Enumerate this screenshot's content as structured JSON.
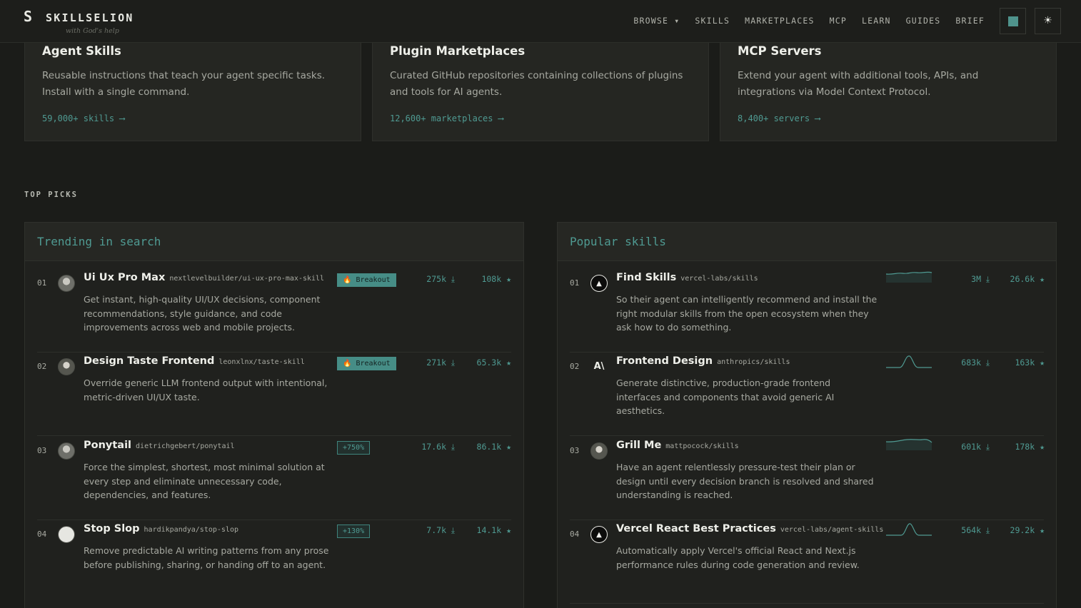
{
  "brand": {
    "mark": "S",
    "name": "SKILLSELION",
    "tagline": "with God's help"
  },
  "nav": {
    "links": [
      "BROWSE ▾",
      "SKILLS",
      "MARKETPLACES",
      "MCP",
      "LEARN",
      "GUIDES",
      "BRIEF"
    ],
    "mode_icon": "☀"
  },
  "cards": [
    {
      "title": "Agent Skills",
      "desc": "Reusable instructions that teach your agent specific tasks. Install with a single command.",
      "count": "59,000+ skills  ⟶"
    },
    {
      "title": "Plugin Marketplaces",
      "desc": "Curated GitHub repositories containing collections of plugins and tools for AI agents.",
      "count": "12,600+ marketplaces  ⟶"
    },
    {
      "title": "MCP Servers",
      "desc": "Extend your agent with additional tools, APIs, and integrations via Model Context Protocol.",
      "count": "8,400+ servers  ⟶"
    }
  ],
  "section_label": "TOP PICKS",
  "trending": {
    "title": "Trending in search",
    "items": [
      {
        "rank": "01",
        "name": "Ui Ux Pro Max",
        "repo": "nextlevelbuilder/ui-ux-pro-max-skill",
        "badge": "🔥 Breakout",
        "badge_type": "breakout",
        "downloads": "275k ⤓",
        "stars": "108k ★",
        "desc": "Get instant, high-quality UI/UX decisions, component recommendations, style guidance, and code improvements across web and mobile projects."
      },
      {
        "rank": "02",
        "name": "Design Taste Frontend",
        "repo": "leonxlnx/taste-skill",
        "badge": "🔥 Breakout",
        "badge_type": "breakout",
        "downloads": "271k ⤓",
        "stars": "65.3k ★",
        "desc": "Override generic LLM frontend output with intentional, metric-driven UI/UX taste."
      },
      {
        "rank": "03",
        "name": "Ponytail",
        "repo": "dietrichgebert/ponytail",
        "badge": "+750%",
        "badge_type": "pct",
        "downloads": "17.6k ⤓",
        "stars": "86.1k ★",
        "desc": "Force the simplest, shortest, most minimal solution at every step and eliminate unnecessary code, dependencies, and features."
      },
      {
        "rank": "04",
        "name": "Stop Slop",
        "repo": "hardikpandya/stop-slop",
        "badge": "+130%",
        "badge_type": "pct",
        "downloads": "7.7k ⤓",
        "stars": "14.1k ★",
        "desc": "Remove predictable AI writing patterns from any prose before publishing, sharing, or handing off to an agent."
      }
    ]
  },
  "popular": {
    "title": "Popular skills",
    "items": [
      {
        "rank": "01",
        "name": "Find Skills",
        "repo": "vercel-labs/skills",
        "downloads": "3M ⤓",
        "stars": "26.6k ★",
        "desc": "So their agent can intelligently recommend and install the right modular skills from the open ecosystem when they ask how to do something."
      },
      {
        "rank": "02",
        "name": "Frontend Design",
        "repo": "anthropics/skills",
        "downloads": "683k ⤓",
        "stars": "163k ★",
        "desc": "Generate distinctive, production-grade frontend interfaces and components that avoid generic AI aesthetics."
      },
      {
        "rank": "03",
        "name": "Grill Me",
        "repo": "mattpocock/skills",
        "downloads": "601k ⤓",
        "stars": "178k ★",
        "desc": "Have an agent relentlessly pressure-test their plan or design until every decision branch is resolved and shared understanding is reached."
      },
      {
        "rank": "04",
        "name": "Vercel React Best Practices",
        "repo": "vercel-labs/agent-skills",
        "downloads": "564k ⤓",
        "stars": "29.2k ★",
        "desc": "Automatically apply Vercel's official React and Next.js performance rules during code generation and review."
      }
    ]
  },
  "colors": {
    "accent": "#4f9a92",
    "bg": "#1b1c19",
    "card": "#252622"
  }
}
